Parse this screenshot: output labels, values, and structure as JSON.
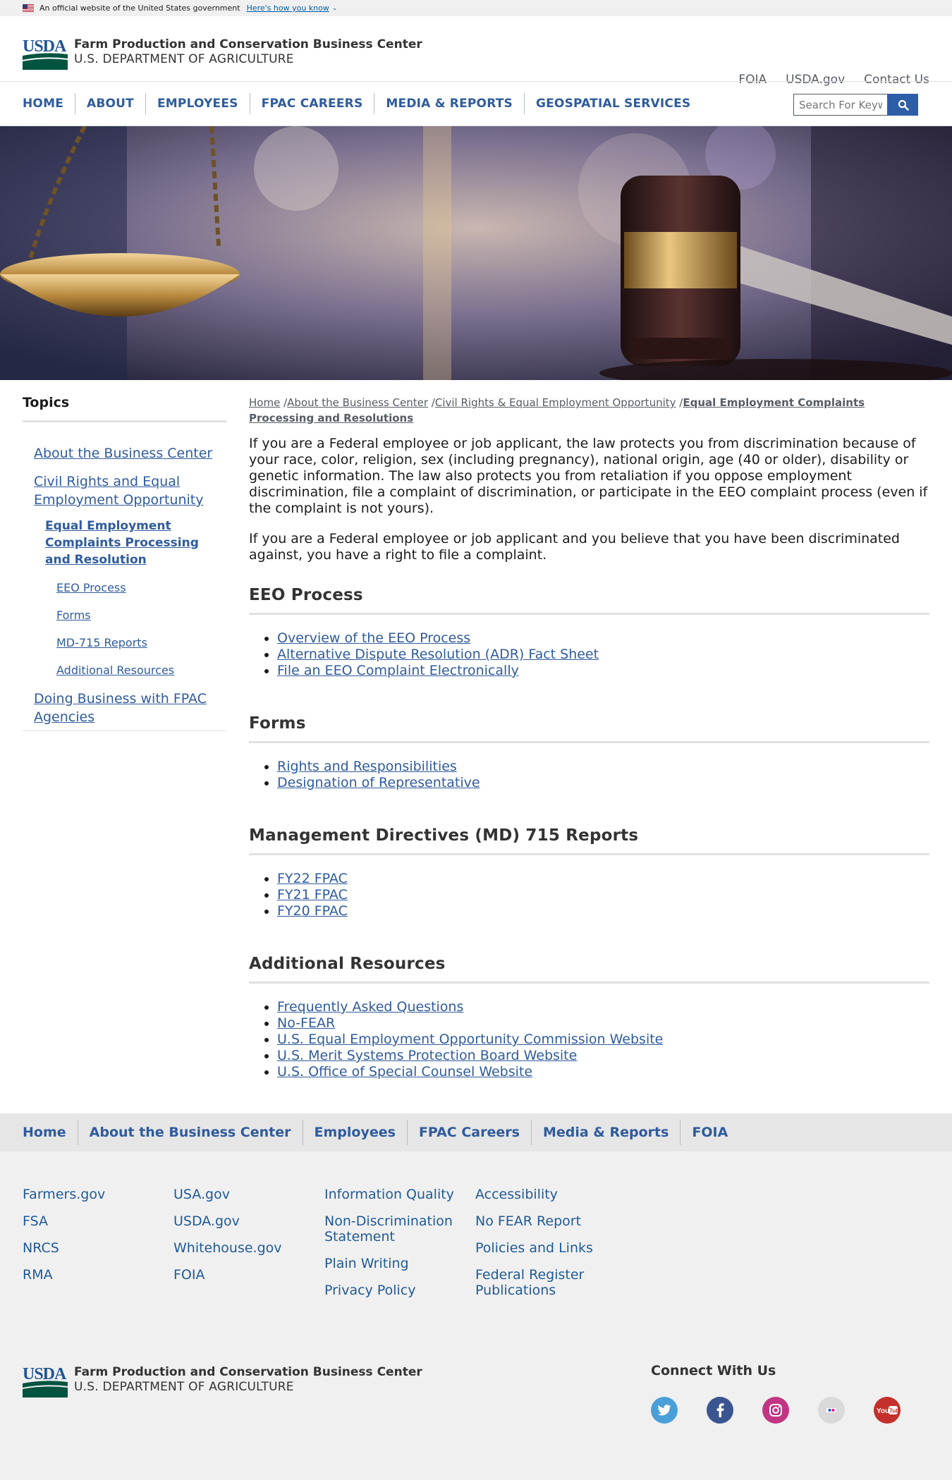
{
  "gov_banner": {
    "text": "An official website of the United States government",
    "link": "Here's how you know"
  },
  "header": {
    "logo_text": "USDA",
    "agency_name": "Farm Production and Conservation Business Center",
    "department": "U.S. DEPARTMENT OF AGRICULTURE",
    "utility_links": [
      "FOIA",
      "USDA.gov",
      "Contact Us"
    ]
  },
  "nav": {
    "items": [
      "HOME",
      "ABOUT",
      "EMPLOYEES",
      "FPAC CAREERS",
      "MEDIA & REPORTS",
      "GEOSPATIAL SERVICES"
    ],
    "search_placeholder": "Search For Keywords"
  },
  "sidebar": {
    "title": "Topics",
    "items": [
      {
        "label": "About the Business Center",
        "level": 1
      },
      {
        "label": "Civil Rights and Equal Employment Opportunity",
        "level": 1
      },
      {
        "label": "Equal Employment Complaints Processing and Resolution",
        "level": 2
      },
      {
        "label": "EEO Process",
        "level": 3
      },
      {
        "label": "Forms",
        "level": 3
      },
      {
        "label": "MD-715 Reports",
        "level": 3
      },
      {
        "label": "Additional Resources",
        "level": 3
      },
      {
        "label": "Doing Business with FPAC Agencies",
        "level": 1
      }
    ]
  },
  "breadcrumb": {
    "home": "Home",
    "sep1": " /",
    "about": "About the Business Center",
    "sep2": " /",
    "civil": "Civil Rights & Equal Employment Opportunity",
    "sep3": " /",
    "current": "Equal Employment Complaints Processing and Resolutions"
  },
  "intro": [
    "If you are a Federal employee or job applicant, the law protects you from discrimination because of your race, color, religion, sex (including pregnancy), national origin, age (40 or older), disability or genetic information. The law also protects you from retaliation if you oppose employment discrimination, file a complaint of discrimination, or participate in the EEO complaint process (even if the complaint is not yours).",
    "If you are a Federal employee or job applicant and you believe that you have been discriminated against, you have a right to file a complaint."
  ],
  "sections": [
    {
      "title": "EEO Process",
      "links": [
        "Overview of the EEO Process",
        "Alternative Dispute Resolution (ADR) Fact Sheet",
        "File an EEO Complaint Electronically"
      ]
    },
    {
      "title": "Forms",
      "links": [
        "Rights and Responsibilities",
        "Designation of Representative"
      ]
    },
    {
      "title": "Management Directives (MD) 715 Reports",
      "links": [
        "FY22 FPAC",
        "FY21 FPAC",
        "FY20 FPAC"
      ]
    },
    {
      "title": "Additional Resources",
      "links": [
        "Frequently Asked Questions",
        "No-FEAR",
        "U.S. Equal Employment Opportunity Commission Website",
        "U.S. Merit Systems Protection Board Website",
        "U.S. Office of Special Counsel Website"
      ]
    }
  ],
  "footer_nav": [
    "Home",
    "About the Business Center",
    "Employees",
    "FPAC Careers",
    "Media & Reports",
    "FOIA"
  ],
  "footer_columns": [
    [
      "Farmers.gov",
      "FSA",
      "NRCS",
      "RMA"
    ],
    [
      "USA.gov",
      "USDA.gov",
      "Whitehouse.gov",
      "FOIA"
    ],
    [
      "Information Quality",
      "Non-Discrimination Statement",
      "Plain Writing",
      "Privacy Policy"
    ],
    [
      "Accessibility",
      "No FEAR Report",
      "Policies and Links",
      "Federal Register Publications"
    ]
  ],
  "footer_bottom": {
    "logo_text": "USDA",
    "agency_name": "Farm Production and Conservation Business Center",
    "department": "U.S. DEPARTMENT OF AGRICULTURE",
    "connect_title": "Connect With Us",
    "social": [
      {
        "name": "twitter-icon",
        "color": "#4a9fd8"
      },
      {
        "name": "facebook-icon",
        "color": "#3b5591"
      },
      {
        "name": "instagram-icon",
        "color": "#c13584"
      },
      {
        "name": "flickr-icon",
        "color": "#d9d9d9"
      },
      {
        "name": "youtube-icon",
        "color": "#c4302b"
      }
    ]
  },
  "colors": {
    "link": "#2f5b9d",
    "usda_green": "#005440",
    "usda_blue": "#205493"
  }
}
